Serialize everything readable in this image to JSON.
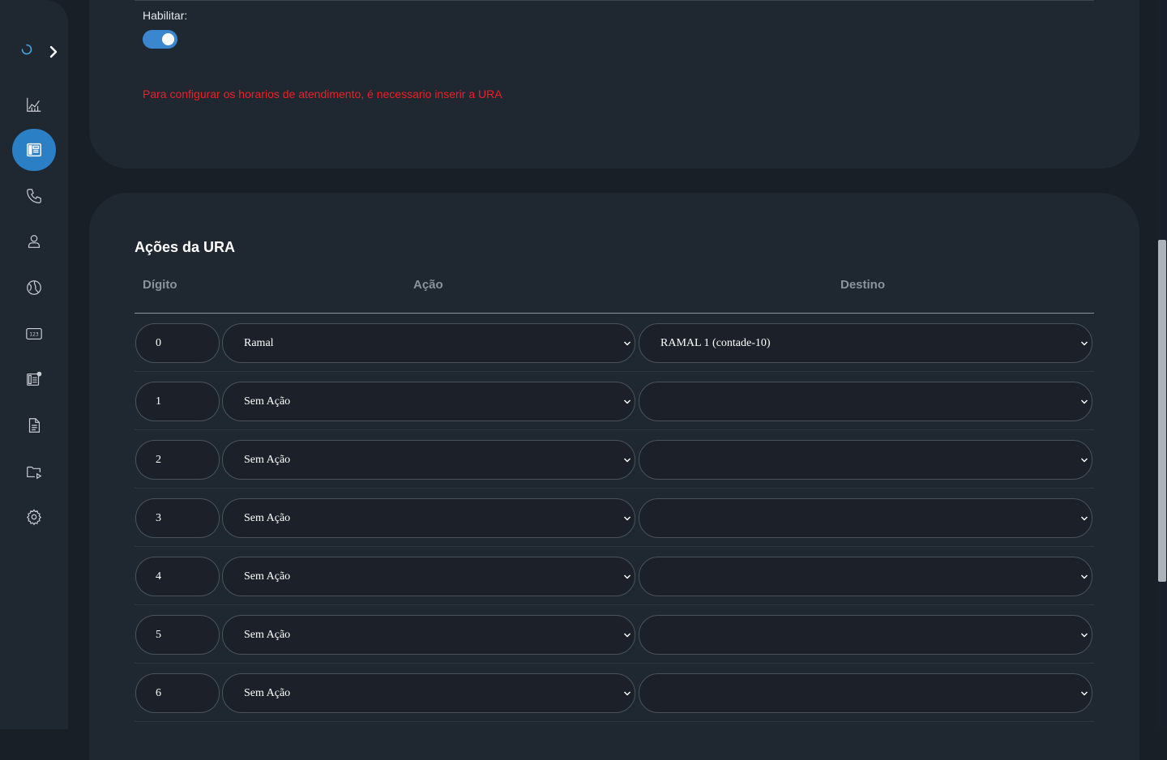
{
  "sidebar": {
    "items": [
      {
        "name": "dashboard",
        "icon": "chart-icon",
        "active": false
      },
      {
        "name": "ura",
        "icon": "phone-book-icon",
        "active": true
      },
      {
        "name": "calls",
        "icon": "phone-icon",
        "active": false
      },
      {
        "name": "users",
        "icon": "user-icon",
        "active": false
      },
      {
        "name": "network",
        "icon": "globe-icon",
        "active": false
      },
      {
        "name": "numbers",
        "icon": "numbers-icon",
        "active": false
      },
      {
        "name": "settings-book",
        "icon": "phone-book-gear-icon",
        "active": false
      },
      {
        "name": "reports",
        "icon": "document-icon",
        "active": false
      },
      {
        "name": "media",
        "icon": "folder-play-icon",
        "active": false
      },
      {
        "name": "settings",
        "icon": "gear-icon",
        "active": false
      }
    ],
    "accent": "#2b7fc4"
  },
  "enable_section": {
    "label": "Habilitar:",
    "toggle_on": true,
    "warning": "Para configurar os horarios de atendimento, é necessario inserir a URA",
    "warning_color": "#f01f26"
  },
  "actions_section": {
    "title": "Ações da URA",
    "columns": {
      "digit": "Dígito",
      "action": "Ação",
      "destination": "Destino"
    },
    "rows": [
      {
        "digit": "0",
        "action": "Ramal",
        "destination": "RAMAL 1 (contade-10)"
      },
      {
        "digit": "1",
        "action": "Sem Ação",
        "destination": ""
      },
      {
        "digit": "2",
        "action": "Sem Ação",
        "destination": ""
      },
      {
        "digit": "3",
        "action": "Sem Ação",
        "destination": ""
      },
      {
        "digit": "4",
        "action": "Sem Ação",
        "destination": ""
      },
      {
        "digit": "5",
        "action": "Sem Ação",
        "destination": ""
      },
      {
        "digit": "6",
        "action": "Sem Ação",
        "destination": ""
      }
    ]
  }
}
